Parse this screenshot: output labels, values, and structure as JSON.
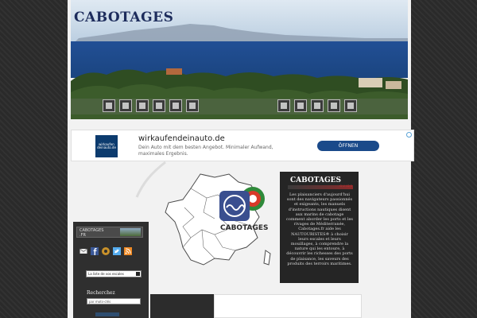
{
  "header": {
    "site_title": "CABOTAGES",
    "toolbar_left_icons": [
      "image-icon",
      "calendar-icon",
      "dial-icon",
      "chart-icon",
      "grid-icon",
      "tool-icon"
    ],
    "toolbar_right_icons": [
      "photo-icon",
      "printer-icon",
      "camera-icon",
      "book-icon",
      "grid-icon"
    ]
  },
  "ad": {
    "logo_line1": "wirkaufen",
    "logo_line2": "deinauto.de",
    "title": "wirkaufendeinauto.de",
    "description": "Dein Auto mit dem besten Angebot. Minimaler Aufwand, maximales Ergebnis.",
    "button_label": "ÖFFNEN",
    "colors": {
      "button": "#1a4a8a"
    }
  },
  "sidebar": {
    "banner_line1": "CABOTAGES",
    "banner_line2": ".FR",
    "share_icons": [
      "mail-icon",
      "facebook-icon",
      "rss-icon",
      "twitter-icon",
      "feed-icon"
    ],
    "select_value": "La liste de vos escales",
    "search_label": "Recherchez",
    "search_placeholder": "par mots-clés"
  },
  "logo": {
    "text": "CABOTAGES"
  },
  "promo": {
    "title": "CABOTAGES",
    "subtitle": "G U I D E",
    "text": "Les plaisanciers d'aujourd'hui sont des navigateurs passionnés et exigeants, les manuels d'instructions nautiques disent aux marins de cabotage comment aborder les ports et les rivages de Méditerranée, Cabotages.fr aide les NAUTOURISTES® à choisir leurs escales et leurs mouillages, à comprendre la nature qui les entoure, à découvrir les richesses des ports de plaisance, les saveurs des produits des terroirs maritimes."
  }
}
